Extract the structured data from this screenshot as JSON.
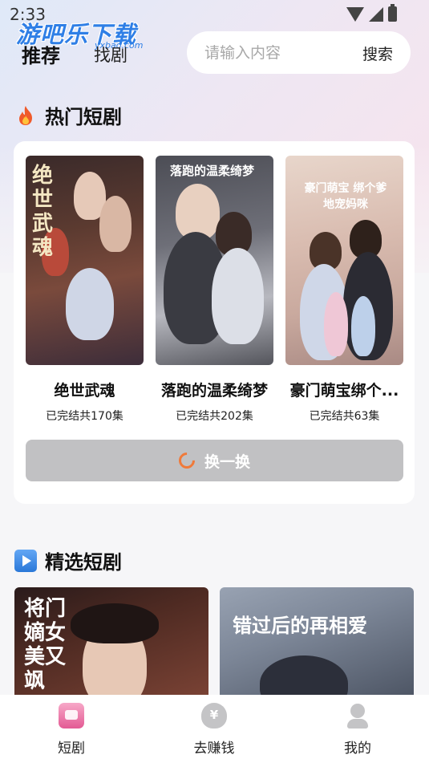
{
  "status_bar": {
    "time": "2:33"
  },
  "watermark": {
    "text": "游吧乐下载",
    "sub": "yxbao.com"
  },
  "header": {
    "tabs": [
      {
        "label": "推荐",
        "active": true
      },
      {
        "label": "找剧",
        "active": false
      }
    ],
    "search": {
      "placeholder": "请输入内容",
      "button_label": "搜索"
    }
  },
  "hot_section": {
    "title": "热门短剧",
    "icon": "flame-icon",
    "items": [
      {
        "name": "绝世武魂",
        "episodes": "已完结共170集",
        "poster_title": "绝世武魂"
      },
      {
        "name": "落跑的温柔绮梦",
        "episodes": "已完结共202集",
        "poster_title": "落跑的温柔绮梦"
      },
      {
        "name": "豪门萌宝绑个...",
        "episodes": "已完结共63集",
        "poster_title": "豪门萌宝 绑个爹地宠妈咪"
      }
    ],
    "refresh_label": "换一换"
  },
  "selected_section": {
    "title": "精选短剧",
    "icon": "play-icon",
    "items": [
      {
        "poster_title": "将门嫡女美又飒"
      },
      {
        "poster_title": "错过后的再相爱"
      }
    ]
  },
  "bottom_nav": {
    "items": [
      {
        "label": "短剧",
        "icon": "video-icon",
        "active": true
      },
      {
        "label": "去赚钱",
        "icon": "money-bag-icon",
        "active": false
      },
      {
        "label": "我的",
        "icon": "user-icon",
        "active": false
      }
    ]
  },
  "colors": {
    "accent": "#f07a3a",
    "refresh_bg": "#c1c1c3",
    "watermark": "#2f7fe6"
  }
}
